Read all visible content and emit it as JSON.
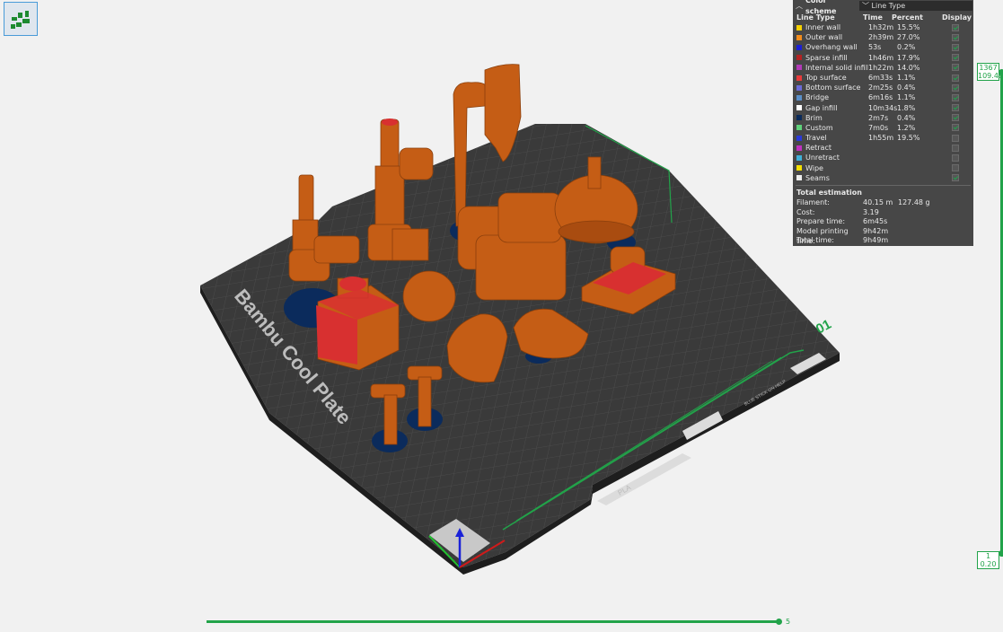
{
  "legend": {
    "collapse_icon": "chevron-up-icon",
    "color_scheme_label": "Color scheme",
    "scheme_value": "Line Type",
    "columns": [
      "Line Type",
      "Time",
      "Percent",
      "Display"
    ],
    "items": [
      {
        "name": "Inner wall",
        "time": "1h32m",
        "percent": "15.5%",
        "color": "#f5d000",
        "display": true,
        "show_check": true
      },
      {
        "name": "Outer wall",
        "time": "2h39m",
        "percent": "27.0%",
        "color": "#f28c1c",
        "display": true,
        "show_check": true
      },
      {
        "name": "Overhang wall",
        "time": "53s",
        "percent": "0.2%",
        "color": "#1b1fd6",
        "display": true,
        "show_check": true
      },
      {
        "name": "Sparse infill",
        "time": "1h46m",
        "percent": "17.9%",
        "color": "#b42222",
        "display": true,
        "show_check": true
      },
      {
        "name": "Internal solid infill",
        "time": "1h22m",
        "percent": "14.0%",
        "color": "#b23ab8",
        "display": true,
        "show_check": true
      },
      {
        "name": "Top surface",
        "time": "6m33s",
        "percent": "1.1%",
        "color": "#e83b3b",
        "display": true,
        "show_check": true
      },
      {
        "name": "Bottom surface",
        "time": "2m25s",
        "percent": "0.4%",
        "color": "#6b6bd8",
        "display": true,
        "show_check": true
      },
      {
        "name": "Bridge",
        "time": "6m16s",
        "percent": "1.1%",
        "color": "#5a8fc8",
        "display": true,
        "show_check": true
      },
      {
        "name": "Gap infill",
        "time": "10m34s",
        "percent": "1.8%",
        "color": "#ffffff",
        "display": true,
        "show_check": true
      },
      {
        "name": "Brim",
        "time": "2m7s",
        "percent": "0.4%",
        "color": "#0a2a5a",
        "display": true,
        "show_check": true
      },
      {
        "name": "Custom",
        "time": "7m0s",
        "percent": "1.2%",
        "color": "#5fd17a",
        "display": true,
        "show_check": true
      },
      {
        "name": "Travel",
        "time": "1h55m",
        "percent": "19.5%",
        "color": "#2b3ad8",
        "display": false,
        "show_check": true
      },
      {
        "name": "Retract",
        "time": "",
        "percent": "",
        "color": "#c030c0",
        "display": false,
        "show_check": true
      },
      {
        "name": "Unretract",
        "time": "",
        "percent": "",
        "color": "#3fb0d8",
        "display": false,
        "show_check": true
      },
      {
        "name": "Wipe",
        "time": "",
        "percent": "",
        "color": "#f5e000",
        "display": false,
        "show_check": true
      },
      {
        "name": "Seams",
        "time": "",
        "percent": "",
        "color": "#eeeeee",
        "display": true,
        "show_check": true
      }
    ],
    "total": {
      "title": "Total estimation",
      "filament_label": "Filament:",
      "filament_length": "40.15 m",
      "filament_weight": "127.48 g",
      "cost_label": "Cost:",
      "cost": "3.19",
      "prepare_label": "Prepare time:",
      "prepare": "6m45s",
      "model_label": "Model printing time:",
      "model": "9h42m",
      "total_label": "Total time:",
      "total": "9h49m"
    }
  },
  "layer_slider": {
    "top_layer": "1367",
    "top_height": "109.48",
    "bottom_layer": "1",
    "bottom_height": "0.20"
  },
  "move_slider": {
    "value": "5"
  },
  "plate": {
    "name_text": "Bambu Cool Plate",
    "number": "01",
    "material": "PLA",
    "info_text": "BLUE STICK ON HELP"
  },
  "colors": {
    "accent": "#22a34a",
    "model": "#c55d15",
    "bed": "#3b3b3b"
  }
}
